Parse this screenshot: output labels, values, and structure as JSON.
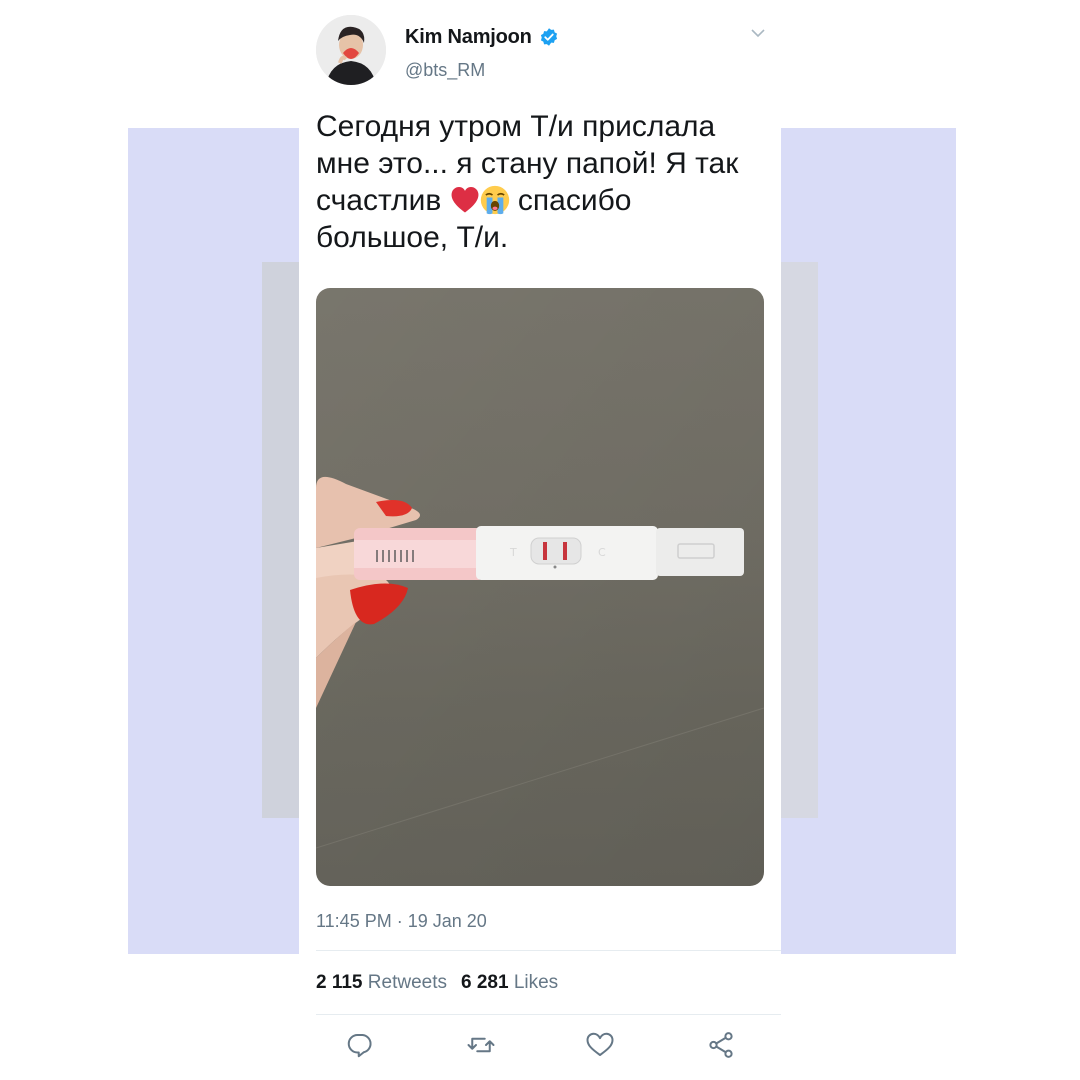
{
  "colors": {
    "background_panel": "#d9dcf7",
    "verified_blue": "#1da1f2",
    "text_primary": "#14171a",
    "text_secondary": "#657786"
  },
  "tweet": {
    "author": {
      "name": "Kim Namjoon",
      "handle": "@bts_RM",
      "verified": true,
      "avatar_icon": "avatar"
    },
    "text": {
      "part1": "Сегодня утром Т/и прислала мне это...  я стану папой! Я так счастлив ",
      "emoji1": "red-heart-emoji",
      "emoji2": "loudly-crying-face-emoji",
      "part2": " спасибо большое, Т/и."
    },
    "media_description_icon": "pregnancy-test-photo",
    "timestamp": "11:45 PM · 19 Jan 20",
    "stats": {
      "retweets_count": "2 115",
      "retweets_label": "Retweets",
      "likes_count": "6 281",
      "likes_label": "Likes"
    },
    "actions": [
      {
        "name": "reply",
        "icon": "reply-icon"
      },
      {
        "name": "retweet",
        "icon": "retweet-icon"
      },
      {
        "name": "like",
        "icon": "heart-icon"
      },
      {
        "name": "share",
        "icon": "share-icon"
      }
    ],
    "menu_icon": "chevron-down-icon"
  }
}
